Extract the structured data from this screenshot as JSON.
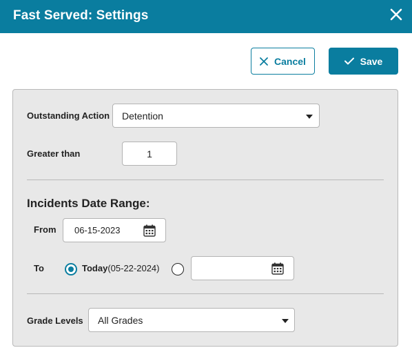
{
  "dialog": {
    "title": "Fast Served: Settings"
  },
  "toolbar": {
    "cancel_label": "Cancel",
    "save_label": "Save"
  },
  "form": {
    "outstanding_action": {
      "label": "Outstanding Action",
      "value": "Detention"
    },
    "greater_than": {
      "label": "Greater than",
      "value": "1"
    },
    "date_range": {
      "title": "Incidents Date Range:",
      "from_label": "From",
      "from_value": "06-15-2023",
      "to_label": "To",
      "today_label": "Today",
      "today_date": "(05-22-2024)",
      "today_selected": true,
      "custom_to_value": ""
    },
    "grade_levels": {
      "label": "Grade Levels",
      "value": "All Grades"
    }
  },
  "colors": {
    "accent": "#0a7d9f",
    "panel_bg": "#e8e8e8"
  },
  "icons": [
    "close-icon",
    "x-icon",
    "checkmark-icon",
    "calendar-icon",
    "dropdown-caret-icon"
  ]
}
